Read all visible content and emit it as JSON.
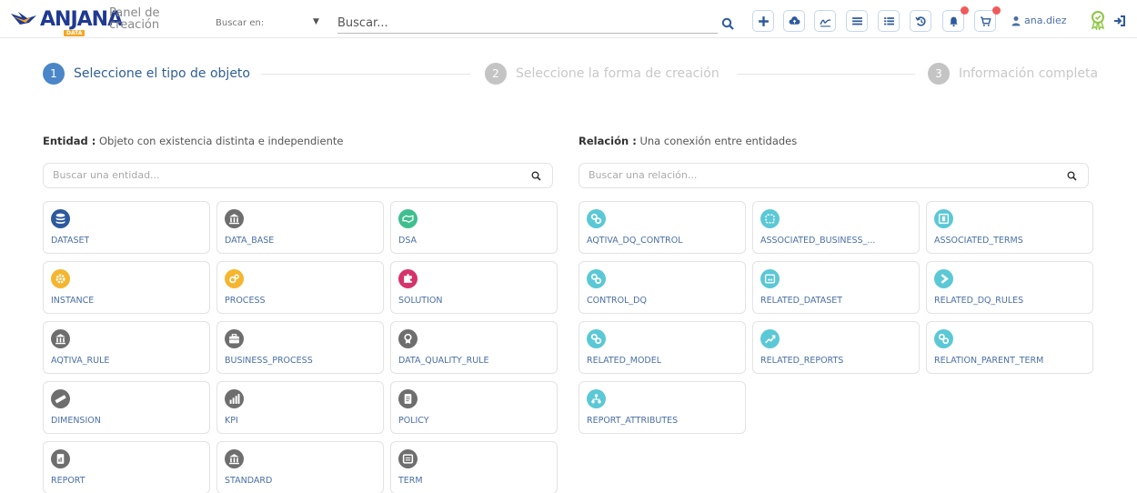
{
  "header": {
    "logo_text": "ANJANA",
    "logo_sub": "DATA",
    "panel_title_1": "Panel de",
    "panel_title_2": "creación",
    "search_in_label": "Buscar en:",
    "search_placeholder": "Buscar...",
    "username": "ana.diez",
    "toolbar_icons": [
      "plus-icon",
      "cloud-upload-icon",
      "signature-icon",
      "list-icon",
      "checklist-icon",
      "history-icon",
      "bell-icon",
      "cart-icon"
    ],
    "badges": [
      "bell-icon",
      "cart-icon"
    ]
  },
  "steps": [
    {
      "num": "1",
      "label": "Seleccione el tipo de objeto",
      "state": "active"
    },
    {
      "num": "2",
      "label": "Seleccione la forma de creación",
      "state": "inactive"
    },
    {
      "num": "3",
      "label": "Información completa",
      "state": "inactive"
    }
  ],
  "entities": {
    "title": "Entidad :",
    "description": "Objeto con existencia distinta e independiente",
    "search_placeholder": "Buscar una entidad...",
    "items": [
      {
        "label": "DATASET",
        "icon": "database-icon",
        "color": "#2d5a9e"
      },
      {
        "label": "DATA_BASE",
        "icon": "building-icon",
        "color": "#6e6e6e"
      },
      {
        "label": "DSA",
        "icon": "handshake-icon",
        "color": "#3fbf8f"
      },
      {
        "label": "INSTANCE",
        "icon": "gear-icon",
        "color": "#f5b52e"
      },
      {
        "label": "PROCESS",
        "icon": "gears-icon",
        "color": "#f5b52e"
      },
      {
        "label": "SOLUTION",
        "icon": "puzzle-icon",
        "color": "#d6336c"
      },
      {
        "label": "AQTIVA_RULE",
        "icon": "building-icon",
        "color": "#6e6e6e"
      },
      {
        "label": "BUSINESS_PROCESS",
        "icon": "briefcase-icon",
        "color": "#6e6e6e"
      },
      {
        "label": "DATA_QUALITY_RULE",
        "icon": "award-icon",
        "color": "#6e6e6e"
      },
      {
        "label": "DIMENSION",
        "icon": "ruler-icon",
        "color": "#6e6e6e"
      },
      {
        "label": "KPI",
        "icon": "bar-chart-icon",
        "color": "#6e6e6e"
      },
      {
        "label": "POLICY",
        "icon": "document-icon",
        "color": "#6e6e6e"
      },
      {
        "label": "REPORT",
        "icon": "report-icon",
        "color": "#6e6e6e"
      },
      {
        "label": "STANDARD",
        "icon": "building-icon",
        "color": "#6e6e6e"
      },
      {
        "label": "TERM",
        "icon": "term-icon",
        "color": "#6e6e6e"
      }
    ]
  },
  "relations": {
    "title": "Relación :",
    "description": "Una conexión entre entidades",
    "search_placeholder": "Buscar una relación...",
    "items": [
      {
        "label": "AQTIVA_DQ_CONTROL",
        "icon": "link-icon",
        "color": "#5bc8d6"
      },
      {
        "label": "ASSOCIATED_BUSINESS_...",
        "icon": "frame-icon",
        "color": "#5bc8d6"
      },
      {
        "label": "ASSOCIATED_TERMS",
        "icon": "columns-icon",
        "color": "#5bc8d6"
      },
      {
        "label": "CONTROL_DQ",
        "icon": "link-icon",
        "color": "#5bc8d6"
      },
      {
        "label": "RELATED_DATASET",
        "icon": "dataset-link-icon",
        "color": "#5bc8d6"
      },
      {
        "label": "RELATED_DQ_RULES",
        "icon": "chevron-right-icon",
        "color": "#5bc8d6"
      },
      {
        "label": "RELATED_MODEL",
        "icon": "link-icon",
        "color": "#5bc8d6"
      },
      {
        "label": "RELATED_REPORTS",
        "icon": "trend-icon",
        "color": "#5bc8d6"
      },
      {
        "label": "RELATION_PARENT_TERM",
        "icon": "link-icon",
        "color": "#5bc8d6"
      },
      {
        "label": "REPORT_ATTRIBUTES",
        "icon": "hierarchy-icon",
        "color": "#5bc8d6"
      }
    ]
  }
}
